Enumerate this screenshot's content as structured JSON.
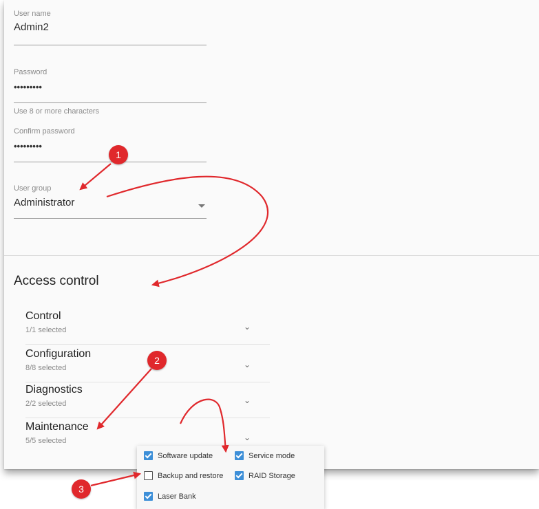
{
  "form": {
    "username": {
      "label": "User name",
      "value": "Admin2"
    },
    "password": {
      "label": "Password",
      "value": "•••••••••",
      "hint": "Use 8 or more characters"
    },
    "confirm_password": {
      "label": "Confirm password",
      "value": "•••••••••"
    },
    "user_group": {
      "label": "User group",
      "value": "Administrator"
    }
  },
  "access_control": {
    "title": "Access control",
    "items": [
      {
        "title": "Control",
        "subtitle": "1/1 selected"
      },
      {
        "title": "Configuration",
        "subtitle": "8/8 selected"
      },
      {
        "title": "Diagnostics",
        "subtitle": "2/2 selected"
      },
      {
        "title": "Maintenance",
        "subtitle": "5/5 selected"
      }
    ],
    "maintenance_options": [
      {
        "label": "Software update",
        "checked": true
      },
      {
        "label": "Service mode",
        "checked": true
      },
      {
        "label": "Backup and restore",
        "checked": false
      },
      {
        "label": "RAID Storage",
        "checked": true
      },
      {
        "label": "Laser Bank",
        "checked": true
      }
    ]
  },
  "callouts": [
    "1",
    "2",
    "3"
  ],
  "colors": {
    "accent": "#3d8fd8",
    "callout": "#e0282c"
  },
  "icons": [
    "dropdown-arrow-icon",
    "chevron-down-icon",
    "checkbox-checked-icon",
    "checkbox-unchecked-icon"
  ]
}
